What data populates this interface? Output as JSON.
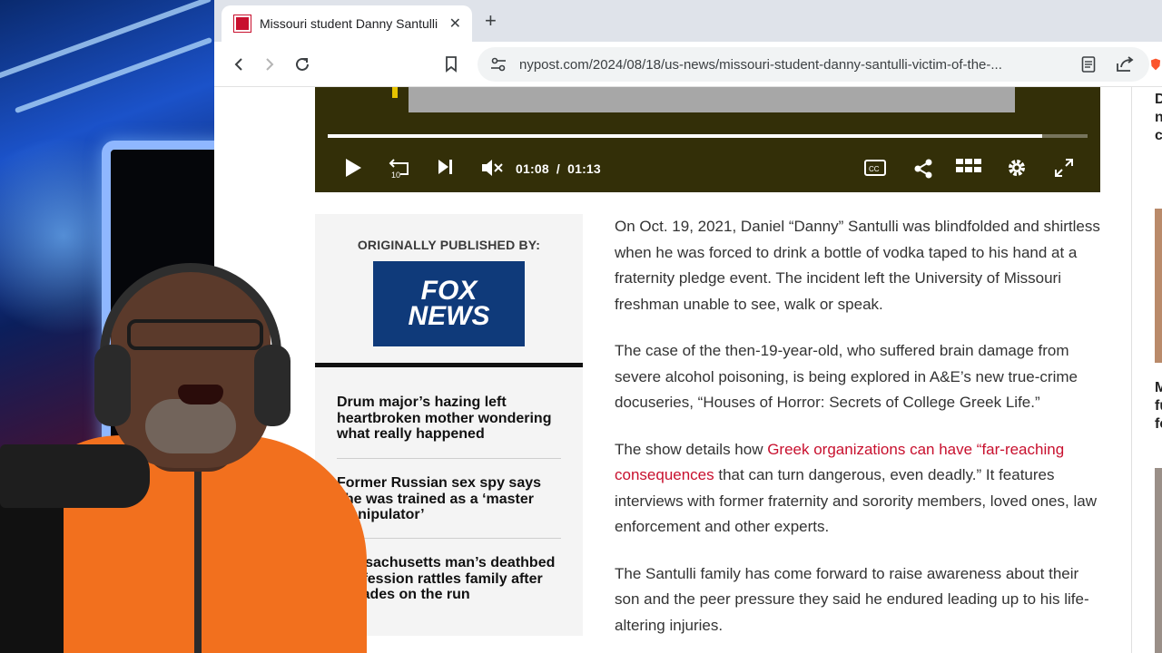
{
  "browser": {
    "tab_title": "Missouri student Danny Santulli",
    "tab_close": "✕",
    "new_tab": "+",
    "url": "nypost.com/2024/08/18/us-news/missouri-student-danny-santulli-victim-of-the-..."
  },
  "video": {
    "current_time": "01:08",
    "separator": "/",
    "duration": "01:13",
    "progress": 0.94,
    "muted": true
  },
  "sidebar": {
    "originally_published_label": "ORIGINALLY PUBLISHED BY:",
    "logo_text": "FOX NEWS",
    "related": [
      "Drum major’s hazing left heartbroken mother wondering what really happened",
      "Former Russian sex spy says she was trained as a ‘master manipulator’",
      "Massachusetts man’s deathbed confession rattles family after decades on the run"
    ]
  },
  "article": {
    "paragraphs": [
      "On Oct. 19, 2021, Daniel “Danny” Santulli was blindfolded and shirtless when he was forced to drink a bottle of vodka taped to his hand at a fraternity pledge event. The incident left the University of Missouri freshman unable to see, walk or speak.",
      "The case of the then-19-year-old, who suffered brain damage from severe alcohol poisoning, is being explored in A&E’s new true-crime docuseries, “Houses of Horror: Secrets of College Greek Life.”"
    ],
    "p3_before": "The show details how ",
    "p3_link": "Greek organizations can have “far-reaching consequences",
    "p3_after": " that can turn dangerous, even deadly.” It features interviews with former fraternity and sorority members, loved ones, law enforcement and other experts.",
    "p4": "The Santulli family has come forward to raise awareness about their son and the peer pressure they said he endured leading up to his life-altering injuries."
  },
  "rail": {
    "text_a": [
      "D",
      "n",
      "c"
    ],
    "text_b": [
      "M",
      "fu",
      "fe"
    ]
  },
  "colors": {
    "link": "#c8102e",
    "video_bg": "#332f08",
    "fox_blue": "#0f3a7a"
  }
}
